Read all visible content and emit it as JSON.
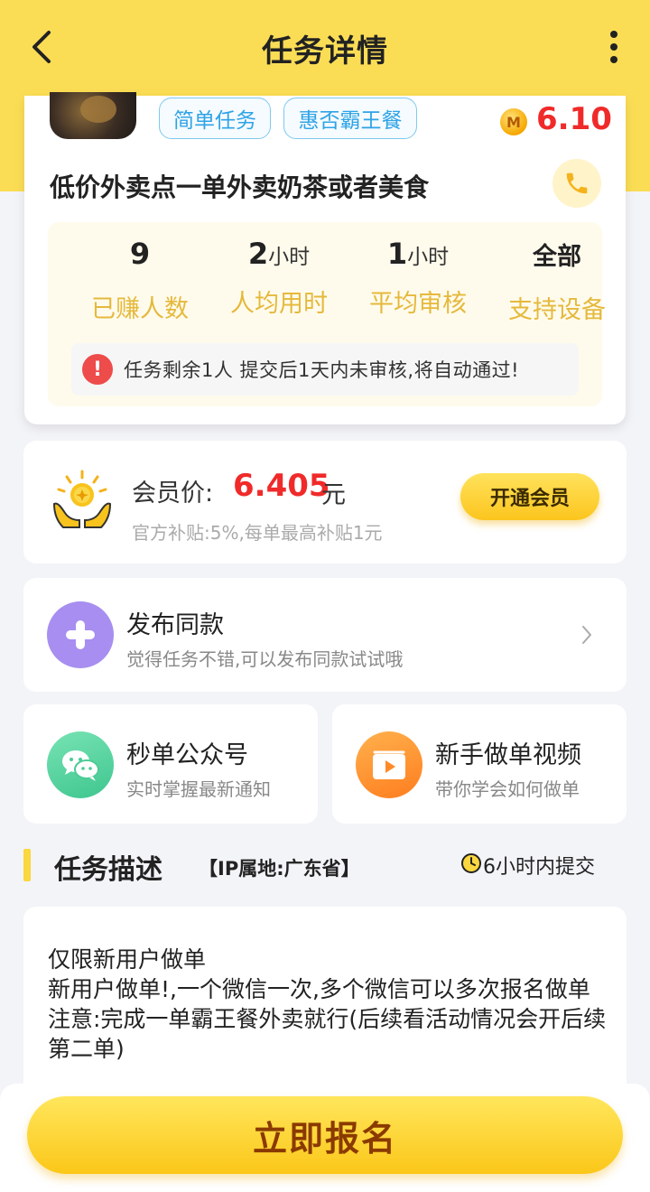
{
  "header": {
    "title": "任务详情"
  },
  "task": {
    "tags": [
      "简单任务",
      "惠否霸王餐"
    ],
    "coin_label": "M",
    "reward": "6.10",
    "title": "低价外卖点一单外卖奶茶或者美食",
    "stats": [
      {
        "value": "9",
        "unit": "",
        "label": "已赚人数"
      },
      {
        "value": "2",
        "unit": "小时",
        "label": "人均用时"
      },
      {
        "value": "1",
        "unit": "小时",
        "label": "平均审核"
      },
      {
        "value": "全部",
        "unit": "",
        "label": "支持设备"
      }
    ],
    "notice_mark": "!",
    "notice": "任务剩余1人  提交后1天内未审核,将自动通过!"
  },
  "vip": {
    "label": "会员价:",
    "price": "6.405",
    "unit": "元",
    "subsidy": "官方补贴:5%,每单最高补贴1元",
    "button": "开通会员"
  },
  "publish": {
    "title": "发布同款",
    "subtitle": "觉得任务不错,可以发布同款试试哦"
  },
  "shortcuts": [
    {
      "title": "秒单公众号",
      "subtitle": "实时掌握最新通知",
      "icon": "wechat-icon"
    },
    {
      "title": "新手做单视频",
      "subtitle": "带你学会如何做单",
      "icon": "video-icon"
    }
  ],
  "description": {
    "heading": "任务描述",
    "ip": "【IP属地:广东省】",
    "deadline": "6小时内提交",
    "body": "仅限新用户做单\n新用户做单!,一个微信一次,多个微信可以多次报名做单\n注意:完成一单霸王餐外卖就行(后续看活动情况会开后续第二单)"
  },
  "footer": {
    "apply_button": "立即报名"
  },
  "colors": {
    "brand_yellow": "#fbdd55",
    "price_red": "#f02a2a",
    "tag_blue": "#2fa3e6",
    "stat_label_gold": "#e5b93c"
  }
}
